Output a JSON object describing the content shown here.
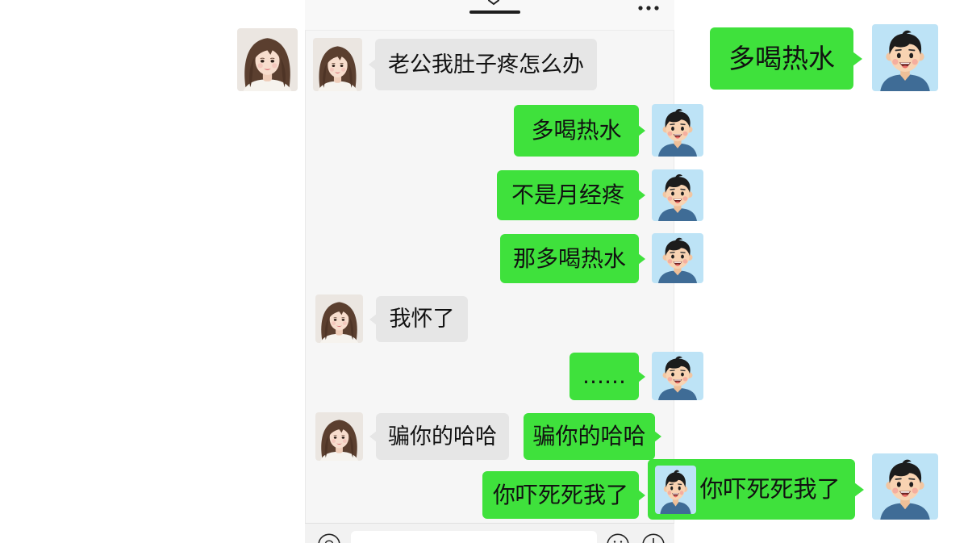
{
  "theme": {
    "outgoing_bubble_color": "#3fe13c",
    "incoming_bubble_color": "#e6e6e6",
    "chat_background": "#f6f6f6"
  },
  "header": {
    "collapse_icon": "chevron-down-icon",
    "drag_handle_icon": "drag-handle-icon",
    "more_icon": "more-dots-icon"
  },
  "avatars": {
    "her": "girlfriend-photo-avatar",
    "me": "cartoon-boy-avatar"
  },
  "chat": {
    "messages": [
      {
        "outgoing": false,
        "text": "老公我肚子疼怎么办"
      },
      {
        "outgoing": true,
        "text": "多喝热水"
      },
      {
        "outgoing": true,
        "text": "不是月经疼"
      },
      {
        "outgoing": true,
        "text": "那多喝热水"
      },
      {
        "outgoing": false,
        "text": "我怀了"
      },
      {
        "outgoing": true,
        "text": "……"
      },
      {
        "outgoing": false,
        "text": "骗你的哈哈"
      },
      {
        "outgoing": true,
        "text": "骗你的哈哈"
      },
      {
        "outgoing": true,
        "text": "你吓死死我了"
      }
    ]
  },
  "overlay": {
    "zoomed_messages": [
      {
        "outgoing": true,
        "text": "多喝热水"
      },
      {
        "outgoing": true,
        "text": "你吓死死我了"
      }
    ]
  },
  "input_bar": {
    "voice_icon": "voice-icon",
    "emoji_icon": "emoji-icon",
    "plus_icon": "plus-icon"
  }
}
